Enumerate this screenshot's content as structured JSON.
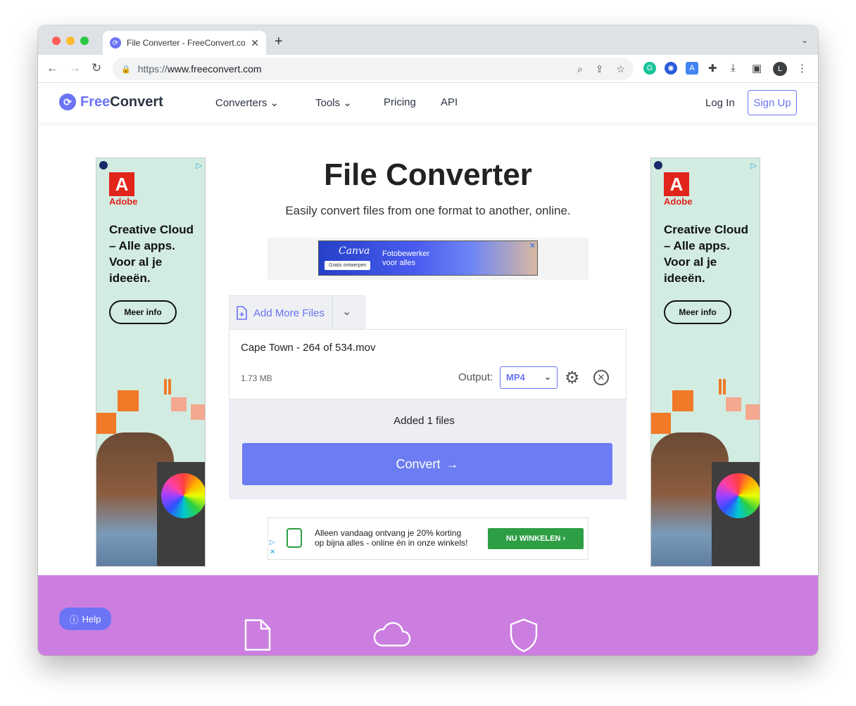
{
  "browser": {
    "tab_title": "File Converter - FreeConvert.com",
    "tab_close": "✕",
    "new_tab": "+",
    "tab_menu": "⌄",
    "url_scheme": "https://",
    "url_host": "www.freeconvert.com",
    "profile_initial": "L"
  },
  "header": {
    "logo_free": "Free",
    "logo_convert": "Convert",
    "nav": [
      "Converters",
      "Tools",
      "Pricing",
      "API"
    ],
    "login": "Log In",
    "signup": "Sign Up"
  },
  "hero": {
    "title": "File Converter",
    "subtitle": "Easily convert files from one format to another, online."
  },
  "top_ad": {
    "brand": "Canva",
    "button": "Gratis ontwerpen",
    "line1": "Fotobewerker",
    "line2": "voor alles"
  },
  "side_ad": {
    "brand": "Adobe",
    "copy": "Creative Cloud – Alle apps. Voor al je ideeën.",
    "cta": "Meer info"
  },
  "uploader": {
    "add_files": "Add More Files",
    "file_name": "Cape Town - 264 of 534.mov",
    "file_size": "1.73 MB",
    "output_label": "Output:",
    "output_value": "MP4",
    "added_text": "Added 1 files",
    "convert": "Convert"
  },
  "bottom_ad": {
    "line1": "Alleen vandaag ontvang je 20% korting",
    "line2": "op bijna alles - online én in onze winkels!",
    "button": "NU WINKELEN"
  },
  "footer": {
    "help": "Help"
  },
  "colors": {
    "accent": "#6b74f5",
    "convert_button": "#6c7cf2",
    "footer_bg": "#cb7ee0",
    "ad_bg": "#d2ece1"
  }
}
